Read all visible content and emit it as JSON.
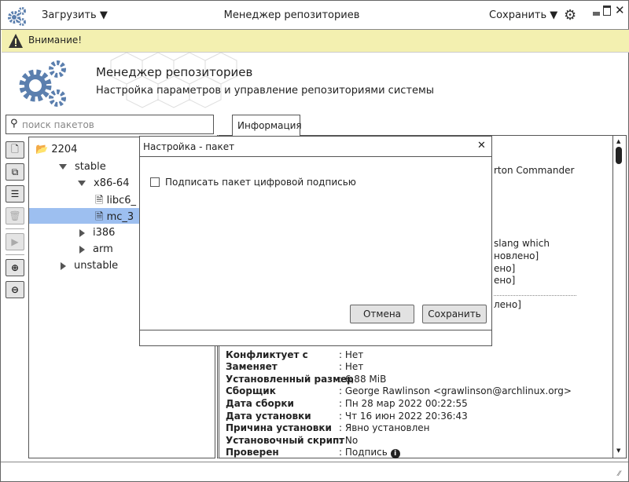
{
  "titlebar": {
    "load_label": "Загрузить",
    "title": "Менеджер репозиториев",
    "save_label": "Сохранить"
  },
  "warning": {
    "text": "Внимание!"
  },
  "header": {
    "title": "Менеджер репозиториев",
    "subtitle": "Настройка параметров и управление репозиториями системы"
  },
  "search": {
    "placeholder": "поиск пакетов"
  },
  "tabs": [
    {
      "label": "Информация"
    }
  ],
  "tree": {
    "root": "2204",
    "items": [
      {
        "label": "stable"
      },
      {
        "label": "x86-64"
      },
      {
        "label": "libc6_"
      },
      {
        "label": "mc_3"
      },
      {
        "label": "i386"
      },
      {
        "label": "arm"
      },
      {
        "label": "unstable"
      }
    ]
  },
  "info_fragments": [
    "rton Commander",
    "slang  which",
    "новлено]",
    "ено]",
    "ено]",
    "лено]"
  ],
  "info_rows": [
    {
      "key": "Конфликтует с",
      "value": ": Нет"
    },
    {
      "key": "Заменяет",
      "value": ": Нет"
    },
    {
      "key": "Установленный размер",
      "value": ": 6,88 MiB"
    },
    {
      "key": "Сборщик",
      "value": ": George Rawlinson <grawlinson@archlinux.org>"
    },
    {
      "key": "Дата сборки",
      "value": ": Пн 28 мар 2022 00:22:55"
    },
    {
      "key": "Дата установки",
      "value": ": Чт 16 июн 2022 20:36:43"
    },
    {
      "key": "Причина установки",
      "value": ": Явно установлен"
    },
    {
      "key": "Установочный скрипт",
      "value": ": No"
    },
    {
      "key": "Проверен",
      "value": ": Подпись"
    }
  ],
  "dialog": {
    "title": "Настройка - пакет",
    "checkbox_label": "Подписать пакет цифровой подписью",
    "checkbox_checked": false,
    "cancel_label": "Отмена",
    "save_label": "Сохранить"
  }
}
